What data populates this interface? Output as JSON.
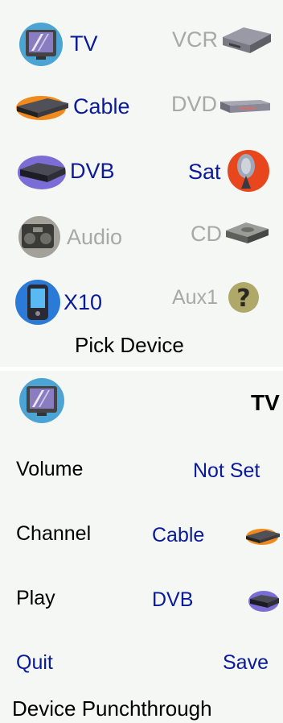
{
  "picker": {
    "devices": [
      {
        "label": "TV",
        "icon": "tv-icon",
        "enabled": true
      },
      {
        "label": "VCR",
        "icon": "vcr-icon",
        "enabled": false
      },
      {
        "label": "Cable",
        "icon": "cable-box-icon",
        "enabled": true
      },
      {
        "label": "DVD",
        "icon": "dvd-player-icon",
        "enabled": false
      },
      {
        "label": "DVB",
        "icon": "dvb-receiver-icon",
        "enabled": true
      },
      {
        "label": "Sat",
        "icon": "satellite-dish-icon",
        "enabled": true
      },
      {
        "label": "Audio",
        "icon": "boombox-icon",
        "enabled": false
      },
      {
        "label": "CD",
        "icon": "cd-player-icon",
        "enabled": false
      },
      {
        "label": "X10",
        "icon": "pda-icon",
        "enabled": true
      },
      {
        "label": "Aux1",
        "icon": "question-mark-icon",
        "enabled": false
      }
    ],
    "title": "Pick Device"
  },
  "punchthrough": {
    "device_name": "TV",
    "device_icon": "tv-icon",
    "rows": [
      {
        "label": "Volume",
        "value": "Not Set"
      },
      {
        "label": "Channel",
        "value": "Cable",
        "icon": "cable-box-icon"
      },
      {
        "label": "Play",
        "value": "DVB",
        "icon": "dvb-receiver-icon"
      }
    ],
    "quit_label": "Quit",
    "save_label": "Save",
    "title": "Device Punchthrough"
  },
  "colors": {
    "active_text": "#0a1a9a",
    "disabled_text": "#a8a8a8",
    "panel_bg": "#f4f7f4"
  }
}
